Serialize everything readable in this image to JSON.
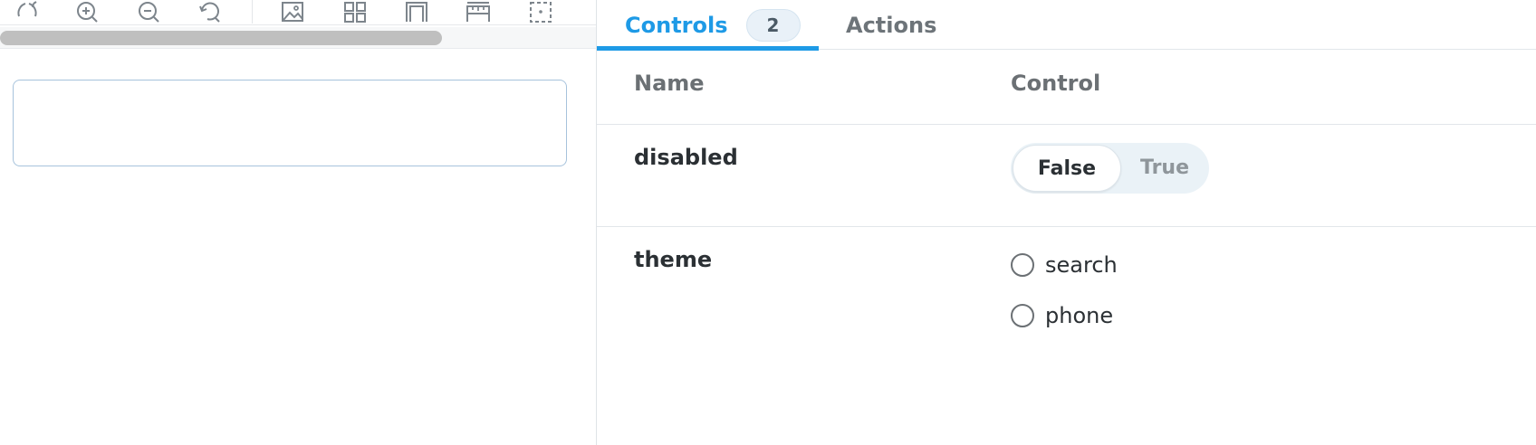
{
  "toolbar": {
    "tools": [
      {
        "icon": "rotate-icon"
      },
      {
        "icon": "zoom-in-icon"
      },
      {
        "icon": "zoom-out-icon"
      },
      {
        "icon": "reset-zoom-icon"
      },
      {
        "icon": "image-background-icon"
      },
      {
        "icon": "grid-icon"
      },
      {
        "icon": "outline-icon"
      },
      {
        "icon": "measure-icon"
      },
      {
        "icon": "viewport-icon"
      }
    ]
  },
  "preview": {
    "input_value": "",
    "input_placeholder": ""
  },
  "panel": {
    "tabs": [
      {
        "label": "Controls",
        "badge": "2",
        "active": true
      },
      {
        "label": "Actions",
        "active": false
      }
    ],
    "columns": {
      "name": "Name",
      "control": "Control"
    },
    "rows": [
      {
        "name": "disabled",
        "control": "boolean",
        "options": [
          "False",
          "True"
        ],
        "selected": "False"
      },
      {
        "name": "theme",
        "control": "radio",
        "options": [
          "search",
          "phone"
        ],
        "selected": null
      }
    ]
  },
  "colors": {
    "accent": "#1e9ae6",
    "input_border": "#a7c3dc",
    "scroll_thumb": "#bfbfbf"
  }
}
